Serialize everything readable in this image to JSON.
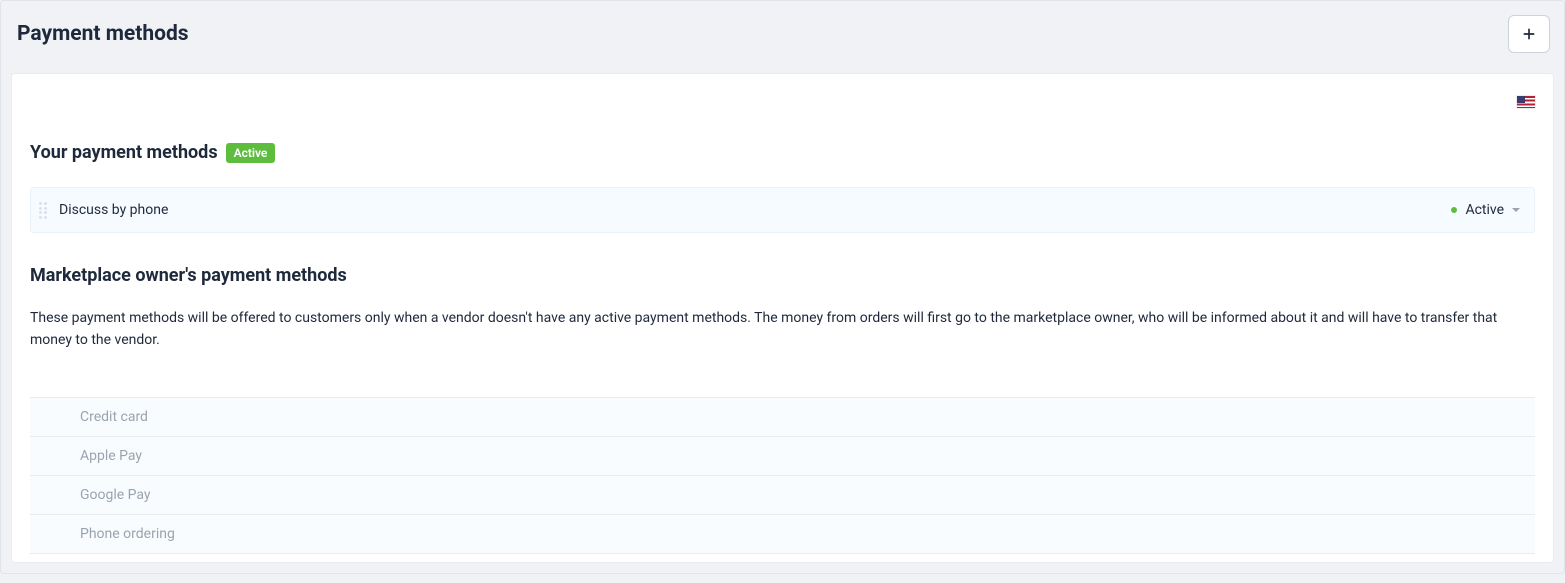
{
  "page_title": "Payment methods",
  "your_methods_heading": "Your payment methods",
  "active_badge": "Active",
  "your_methods": [
    {
      "name": "Discuss by phone",
      "status": "Active",
      "status_color": "#5ebd3e"
    }
  ],
  "owner_methods_heading": "Marketplace owner's payment methods",
  "owner_methods_description": "These payment methods will be offered to customers only when a vendor doesn't have any active payment methods. The money from orders will first go to the marketplace owner, who will be informed about it and will have to transfer that money to the vendor.",
  "owner_methods": [
    {
      "name": "Credit card"
    },
    {
      "name": "Apple Pay"
    },
    {
      "name": "Google Pay"
    },
    {
      "name": "Phone ordering"
    }
  ]
}
